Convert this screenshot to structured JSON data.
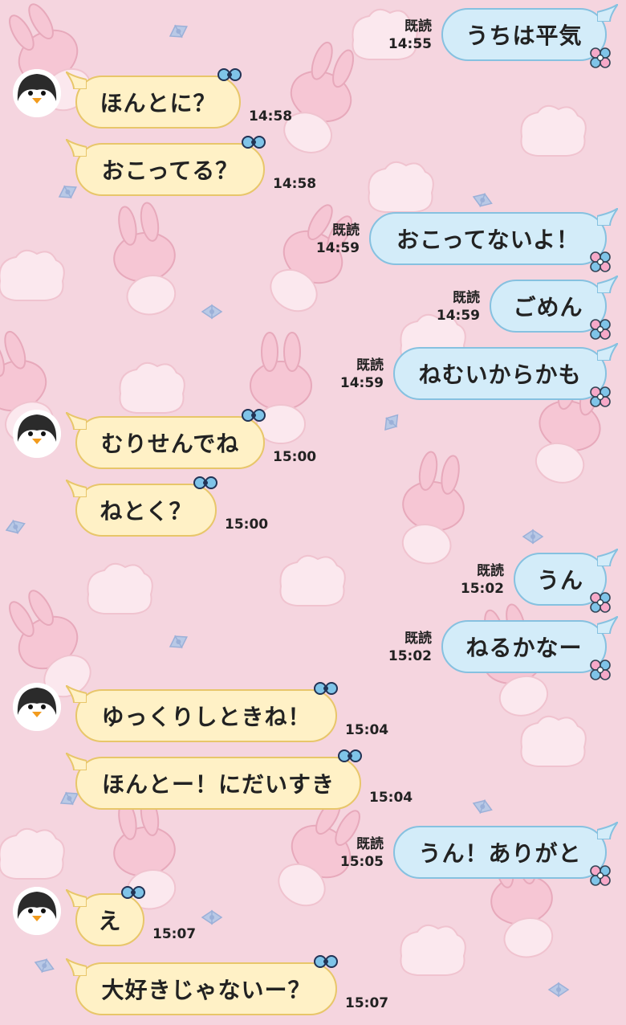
{
  "colors": {
    "background": "#f5d5df",
    "incoming_bubble": "#fff1c6",
    "outgoing_bubble": "#d3ecf9"
  },
  "read_label": "既読",
  "avatar_icon": "penguin-icon",
  "messages": [
    {
      "dir": "out",
      "text": "うちは平気",
      "time": "14:55",
      "read": true
    },
    {
      "dir": "in",
      "text": "ほんとに？",
      "time": "14:58",
      "avatar": true
    },
    {
      "dir": "in",
      "text": "おこってる？",
      "time": "14:58"
    },
    {
      "dir": "out",
      "text": "おこってないよ！",
      "time": "14:59",
      "read": true
    },
    {
      "dir": "out",
      "text": "ごめん",
      "time": "14:59",
      "read": true
    },
    {
      "dir": "out",
      "text": "ねむいからかも",
      "time": "14:59",
      "read": true
    },
    {
      "dir": "in",
      "text": "むりせんでね",
      "time": "15:00",
      "avatar": true
    },
    {
      "dir": "in",
      "text": "ねとく？",
      "time": "15:00"
    },
    {
      "dir": "out",
      "text": "うん",
      "time": "15:02",
      "read": true
    },
    {
      "dir": "out",
      "text": "ねるかなー",
      "time": "15:02",
      "read": true
    },
    {
      "dir": "in",
      "text": "ゆっくりしときね！",
      "time": "15:04",
      "avatar": true
    },
    {
      "dir": "in",
      "text": "ほんとー！にだいすき",
      "time": "15:04"
    },
    {
      "dir": "out",
      "text": "うん！ありがと",
      "time": "15:05",
      "read": true
    },
    {
      "dir": "in",
      "text": "え",
      "time": "15:07",
      "avatar": true
    },
    {
      "dir": "in",
      "text": "大好きじゃないー？",
      "time": "15:07"
    }
  ]
}
